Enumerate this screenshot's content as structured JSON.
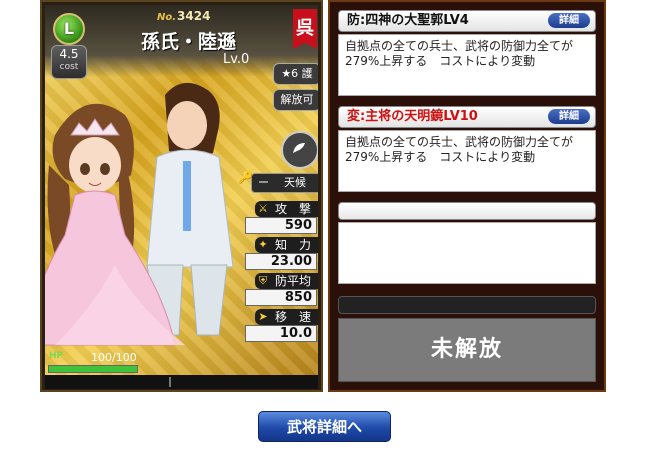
{
  "card": {
    "rarity_letter": "L",
    "cost_value": "4.5",
    "cost_label": "cost",
    "number_prefix": "No.",
    "number": "3424",
    "name": "孫氏・陸遜",
    "level": "Lv.0",
    "clan": "呉",
    "guard_label": "★6 護",
    "release_label": "解放可",
    "skill_dash": "ー",
    "skill_name": "天候",
    "stats": [
      {
        "label": "攻　撃",
        "value": "590",
        "icon": "sword-icon"
      },
      {
        "label": "知　力",
        "value": "23.00",
        "icon": "star-icon"
      },
      {
        "label": "防平均",
        "value": "850",
        "icon": "shield-icon"
      },
      {
        "label": "移　速",
        "value": "10.0",
        "icon": "boot-icon"
      }
    ],
    "hp_label": "HP",
    "hp_value": "100/100",
    "hp_fraction": 1.0
  },
  "skills": [
    {
      "title": "防:四神の大聖郭LV4",
      "detail": "詳細",
      "description": "自拠点の全ての兵士、武将の防御力全てが279%上昇する　コストにより変動"
    },
    {
      "title": "変:主将の天明鏡LV10",
      "detail": "詳細",
      "description": "自拠点の全ての兵士、武将の防御力全てが279%上昇する　コストにより変動"
    }
  ],
  "locked_label": "未解放",
  "detail_page_button": "武将詳細へ",
  "colors": {
    "accent_blue": "#1e4aa8",
    "variant_red": "#d01010",
    "clan_red": "#c8101c"
  }
}
